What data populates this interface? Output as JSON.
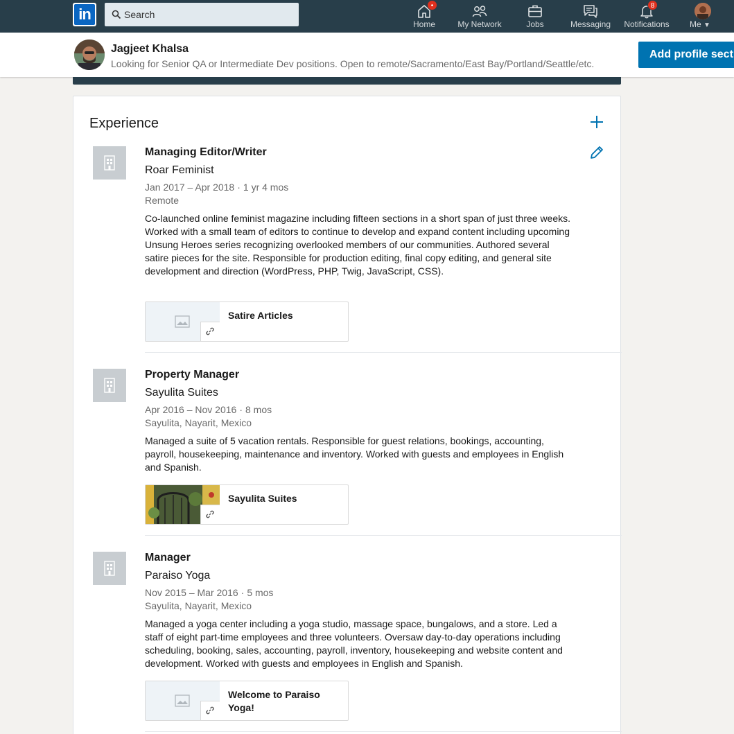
{
  "nav": {
    "search_placeholder": "Search",
    "items": [
      {
        "label": "Home",
        "badge": "•"
      },
      {
        "label": "My Network"
      },
      {
        "label": "Jobs"
      },
      {
        "label": "Messaging"
      },
      {
        "label": "Notifications",
        "badge": "8"
      },
      {
        "label": "Me"
      }
    ]
  },
  "profile": {
    "name": "Jagjeet Khalsa",
    "headline": "Looking for Senior QA or Intermediate Dev positions. Open to remote/Sacramento/East Bay/Portland/Seattle/etc.",
    "add_section_label": "Add profile section"
  },
  "experience": {
    "title": "Experience",
    "entries": [
      {
        "title": "Managing Editor/Writer",
        "company": "Roar Feminist",
        "date_range": "Jan 2017 – Apr 2018",
        "duration": "1 yr 4 mos",
        "location": "Remote",
        "description": "Co-launched online feminist magazine including fifteen sections in a short span of just three weeks. Worked with a small team of editors to continue to develop and expand content including upcoming Unsung Heroes series recognizing overlooked members of our communities. Authored several satire pieces for the site. Responsible for production editing, final copy editing, and general site development and direction (WordPress, PHP, Twig, JavaScript, CSS).",
        "media_label": "Satire Articles"
      },
      {
        "title": "Property Manager",
        "company": "Sayulita Suites",
        "date_range": "Apr 2016 – Nov 2016",
        "duration": "8 mos",
        "location": "Sayulita, Nayarit, Mexico",
        "description": "Managed a suite of 5 vacation rentals. Responsible for guest relations, bookings, accounting, payroll, housekeeping, maintenance and inventory. Worked with guests and employees in English and Spanish.",
        "media_label": "Sayulita Suites"
      },
      {
        "title": "Manager",
        "company": "Paraiso Yoga",
        "date_range": "Nov 2015 – Mar 2016",
        "duration": "5 mos",
        "location": "Sayulita, Nayarit, Mexico",
        "description": "Managed a yoga center including a yoga studio, massage space, bungalows, and a store. Led a staff of eight part-time employees and three volunteers. Oversaw day-to-day operations including scheduling, booking, sales, accounting, payroll, inventory, housekeeping and website content and development. Worked with guests and employees in English and Spanish.",
        "media_label": "Welcome to Paraiso Yoga!"
      }
    ]
  },
  "colors": {
    "nav_bg": "#283e4a",
    "accent_blue": "#0073b1",
    "badge_red": "#e0301e"
  }
}
